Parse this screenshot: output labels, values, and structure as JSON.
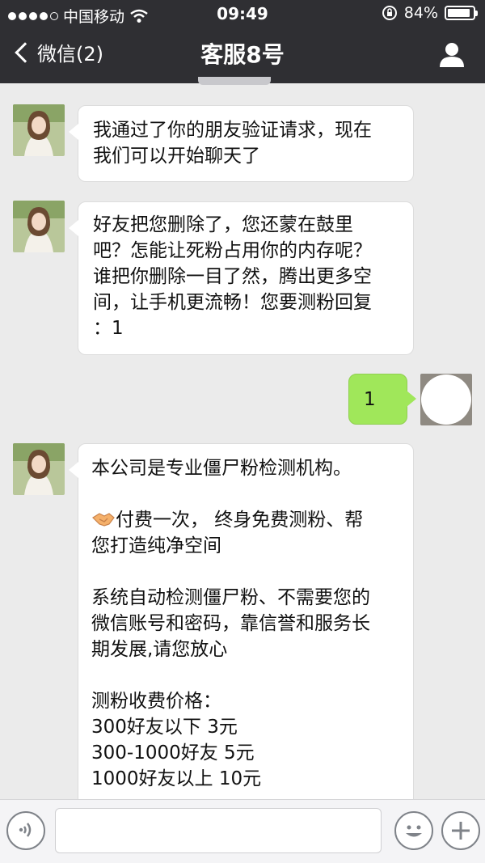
{
  "status_bar": {
    "carrier": "中国移动",
    "time": "09:49",
    "battery": "84%",
    "battery_level": 0.84
  },
  "nav": {
    "back_label": "微信(2)",
    "title": "客服8号"
  },
  "messages": [
    {
      "side": "left",
      "text": "我通过了你的朋友验证请求，现在\n我们可以开始聊天了"
    },
    {
      "side": "left",
      "text": "好友把您删除了，您还蒙在鼓里\n吧？怎能让死粉占用你的内存呢？\n谁把你删除一目了然，腾出更多空\n间，让手机更流畅！您要测粉回复\n：1"
    },
    {
      "side": "right",
      "text": "1"
    },
    {
      "side": "left",
      "lines": {
        "l1": "本公司是专业僵尸粉检测机构。",
        "emoji": "handshake",
        "l2": "付费一次， 终身免费测粉、帮\n您打造纯净空间",
        "l3": "系统自动检测僵尸粉、不需要您的\n微信账号和密码，靠信誉和服务长\n期发展,请您放心",
        "l4": "测粉收费价格：\n300好友以下 3元\n300-1000好友 5元\n1000好友以上 10元"
      }
    }
  ],
  "colors": {
    "header": "#2f2f33",
    "background": "#ebebeb",
    "sent_bubble": "#a0e75a",
    "received_bubble": "#ffffff"
  },
  "icons": [
    "signal-dots-icon",
    "wifi-icon",
    "rotation-lock-icon",
    "battery-icon",
    "back-chevron-icon",
    "profile-icon",
    "voice-icon",
    "emoji-icon",
    "plus-icon"
  ]
}
